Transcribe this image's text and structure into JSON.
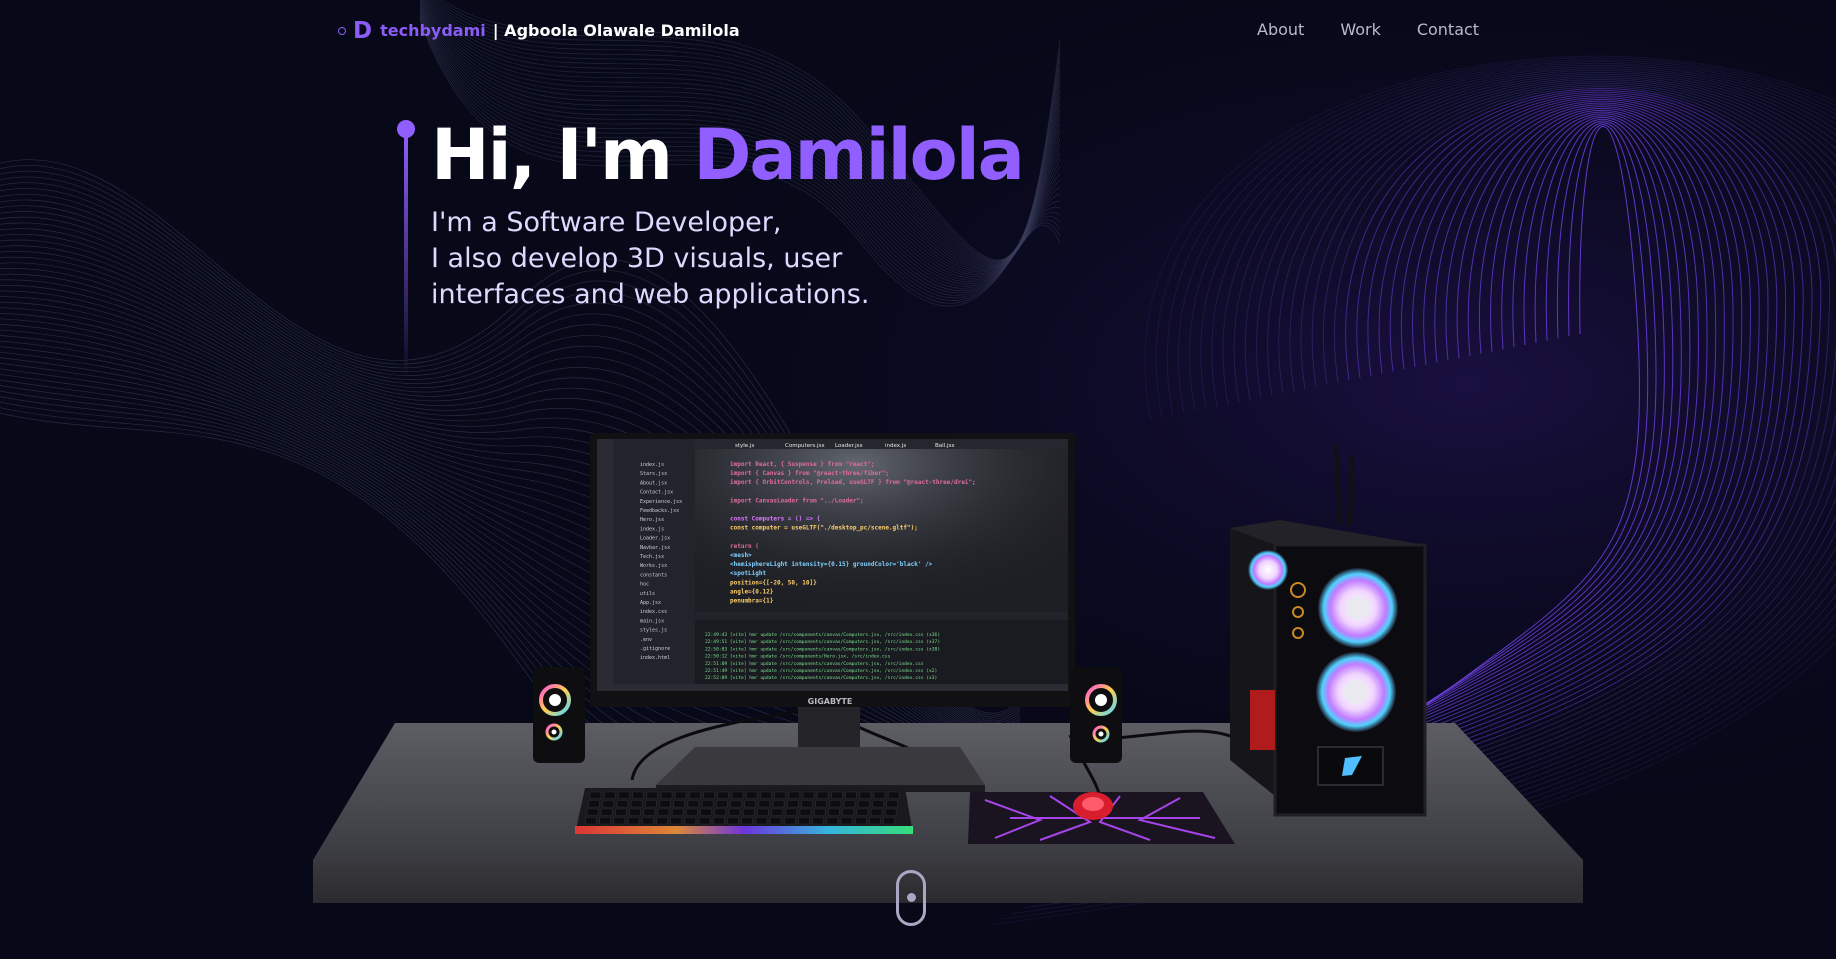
{
  "nav": {
    "brand": "techbydami",
    "owner": "| Agboola Olawale Damilola",
    "logo_letter": "D",
    "links": [
      {
        "label": "About"
      },
      {
        "label": "Work"
      },
      {
        "label": "Contact"
      }
    ]
  },
  "hero": {
    "greeting": "Hi, I'm ",
    "name": "Damilola",
    "lines": [
      "I'm a Software Developer,",
      "I also develop 3D visuals, user",
      "interfaces and web applications."
    ]
  },
  "scene": {
    "monitor_brand": "GIGABYTE",
    "editor_tabs": [
      "style.js",
      "Computers.jsx",
      "Loader.jsx",
      "index.js",
      "Ball.jsx"
    ],
    "explorer_files": [
      "index.js",
      "Stars.jsx",
      "About.jsx",
      "Contact.jsx",
      "Experience.jsx",
      "Feedbacks.jsx",
      "Hero.jsx",
      "index.js",
      "Loader.jsx",
      "Navbar.jsx",
      "Tech.jsx",
      "Works.jsx",
      "constants",
      "hoc",
      "utils",
      "App.jsx",
      "index.css",
      "main.jsx",
      "styles.js",
      ".env",
      ".gitignore",
      "index.html"
    ],
    "code_lines": [
      "import React, { Suspense } from \"react\";",
      "import { Canvas } from \"@react-three/fiber\";",
      "import { OrbitControls, Preload, useGLTF } from \"@react-three/drei\";",
      "",
      "import CanvasLoader from \"../Loader\";",
      "",
      "const Computers = () => {",
      "  const computer = useGLTF(\"./desktop_pc/scene.gltf\");",
      "",
      "  return (",
      "    <mesh>",
      "      <hemisphereLight intensity={0.15} groundColor='black' />",
      "      <spotLight",
      "        position={[-20, 50, 10]}",
      "        angle={0.12}",
      "        penumbra={1}"
    ],
    "terminal_lines": [
      "22:49:43 [vite] hmr update /src/components/canvas/Computers.jsx, /src/index.css (x36)",
      "22:49:51 [vite] hmr update /src/components/canvas/Computers.jsx, /src/index.css (x37)",
      "22:50:03 [vite] hmr update /src/components/canvas/Computers.jsx, /src/index.css (x38)",
      "22:50:12 [vite] hmr update /src/components/Hero.jsx, /src/index.css",
      "22:51:09 [vite] hmr update /src/components/canvas/Computers.jsx, /src/index.css",
      "22:51:49 [vite] hmr update /src/components/canvas/Computers.jsx, /src/index.css (x2)",
      "22:52:09 [vite] hmr update /src/components/canvas/Computers.jsx, /src/index.css (x3)"
    ]
  },
  "colors": {
    "accent": "#915eff",
    "background": "#070818",
    "nav_link": "#b9b9c8",
    "subtitle": "#dfd9ff"
  }
}
